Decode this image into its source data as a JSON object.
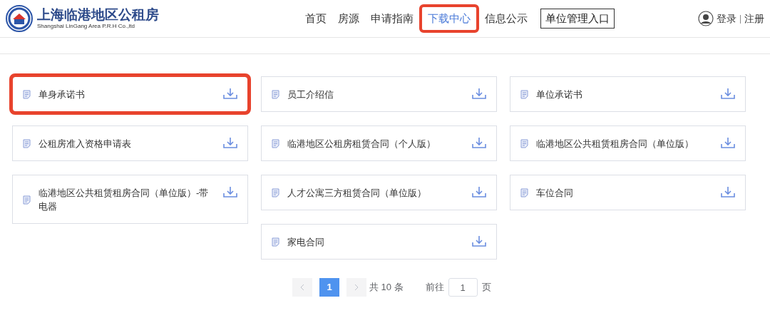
{
  "logo": {
    "title": "上海临港地区公租房",
    "subtitle": "Shangshai LinGang Area P.R.H Co.,ltd"
  },
  "nav": [
    {
      "label": "首页",
      "selected": false,
      "highlighted": false
    },
    {
      "label": "房源",
      "selected": false,
      "highlighted": false
    },
    {
      "label": "申请指南",
      "selected": false,
      "highlighted": false
    },
    {
      "label": "下载中心",
      "selected": true,
      "highlighted": true
    },
    {
      "label": "信息公示",
      "selected": false,
      "highlighted": false
    }
  ],
  "unit_entry": "单位管理入口",
  "account": {
    "login": "登录",
    "separator": "|",
    "register": "注册"
  },
  "files": [
    {
      "name": "单身承诺书",
      "highlighted": true
    },
    {
      "name": "员工介绍信",
      "highlighted": false
    },
    {
      "name": "单位承诺书",
      "highlighted": false
    },
    {
      "name": "公租房准入资格申请表",
      "highlighted": false
    },
    {
      "name": "临港地区公租房租赁合同（个人版）",
      "highlighted": false
    },
    {
      "name": "临港地区公共租赁租房合同（单位版）",
      "highlighted": false
    },
    {
      "name": "临港地区公共租赁租房合同（单位版）-带电器",
      "highlighted": false
    },
    {
      "name": "人才公寓三方租赁合同（单位版）",
      "highlighted": false
    },
    {
      "name": "车位合同",
      "highlighted": false
    },
    {
      "name": "家电合同",
      "highlighted": false
    }
  ],
  "pagination": {
    "pages": [
      {
        "label": "1",
        "selected": true
      }
    ],
    "total": "共 10 条",
    "goto_label": "前往",
    "goto_value": "1",
    "page_unit": "页"
  }
}
